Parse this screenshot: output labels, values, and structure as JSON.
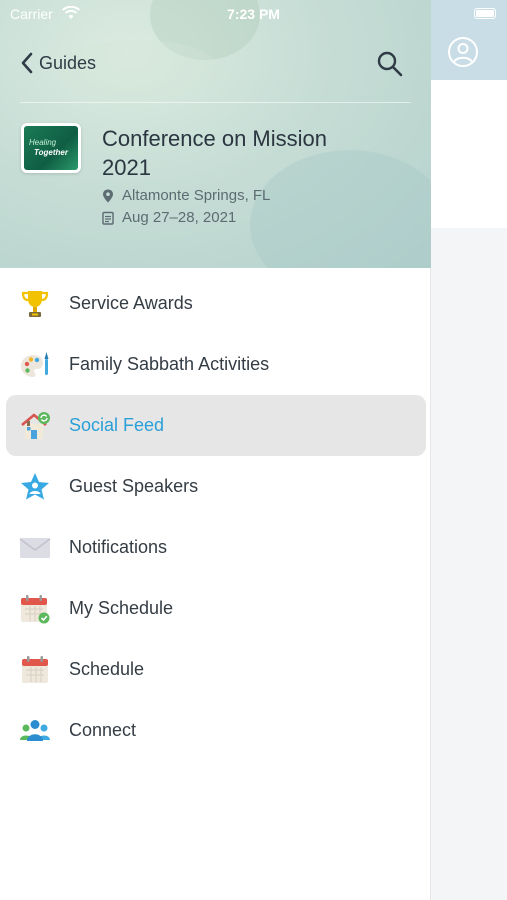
{
  "status_bar": {
    "carrier": "Carrier",
    "time": "7:23 PM"
  },
  "header": {
    "back_label": "Guides",
    "event": {
      "title": "Conference on Mission 2021",
      "location": "Altamonte Springs, FL",
      "dates": "Aug 27–28, 2021",
      "logo_text_line1": "Healing",
      "logo_text_line2": "Together"
    }
  },
  "menu": {
    "items": [
      {
        "label": "Service Awards",
        "icon": "trophy-icon"
      },
      {
        "label": "Family Sabbath Activities",
        "icon": "palette-icon"
      },
      {
        "label": "Social Feed",
        "icon": "house-sync-icon",
        "active": true
      },
      {
        "label": "Guest Speakers",
        "icon": "star-person-icon"
      },
      {
        "label": "Notifications",
        "icon": "envelope-icon"
      },
      {
        "label": "My Schedule",
        "icon": "calendar-check-icon"
      },
      {
        "label": "Schedule",
        "icon": "calendar-icon"
      },
      {
        "label": "Connect",
        "icon": "people-icon"
      }
    ]
  },
  "colors": {
    "active_label": "#2a9fd8",
    "active_background": "#e6e6e6",
    "header_tint": "#c6ddd5",
    "text": "#343c44"
  }
}
